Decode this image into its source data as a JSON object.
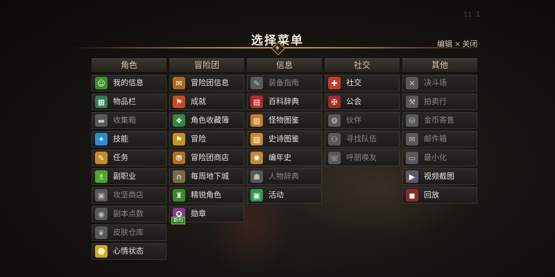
{
  "background": {
    "corner_number": "11 1"
  },
  "header": {
    "title": "选择菜单",
    "edit_label": "编辑",
    "close_x": "×",
    "close_label": "关闭"
  },
  "columns": [
    {
      "header": "角色",
      "items": [
        {
          "label": "我的信息",
          "icon": "character-icon",
          "glyph": "☺",
          "color": "#3f8d2f",
          "dim": false
        },
        {
          "label": "物品栏",
          "icon": "inventory-bag-icon",
          "glyph": "▦",
          "color": "#2f7d52",
          "dim": false
        },
        {
          "label": "收集箱",
          "icon": "collection-box-icon",
          "glyph": "▬",
          "color": "#777",
          "dim": true
        },
        {
          "label": "技能",
          "icon": "skill-star-icon",
          "glyph": "✦",
          "color": "#2a8fcf",
          "dim": false
        },
        {
          "label": "任务",
          "icon": "quest-scroll-icon",
          "glyph": "✎",
          "color": "#c98a2a",
          "dim": false
        },
        {
          "label": "副职业",
          "icon": "potion-icon",
          "glyph": "♗",
          "color": "#4fa52a",
          "dim": false
        },
        {
          "label": "攻坚商店",
          "icon": "raid-shop-icon",
          "glyph": "▣",
          "color": "#777",
          "dim": true
        },
        {
          "label": "副本点数",
          "icon": "dungeon-points-icon",
          "glyph": "◉",
          "color": "#777",
          "dim": true
        },
        {
          "label": "皮肤仓库",
          "icon": "skin-storage-icon",
          "glyph": "❦",
          "color": "#777",
          "dim": true
        },
        {
          "label": "心情状态",
          "icon": "mood-smiley-icon",
          "glyph": "☻",
          "color": "#d8a81a",
          "dim": false
        }
      ]
    },
    {
      "header": "冒险团",
      "items": [
        {
          "label": "冒险团信息",
          "icon": "guild-scroll-icon",
          "glyph": "✉",
          "color": "#b06820",
          "dim": false
        },
        {
          "label": "成就",
          "icon": "achievement-banner-icon",
          "glyph": "⚑",
          "color": "#c84a20",
          "dim": false
        },
        {
          "label": "角色收藏簿",
          "icon": "character-album-icon",
          "glyph": "❖",
          "color": "#2f8a3a",
          "dim": false
        },
        {
          "label": "冒险",
          "icon": "adventure-flag-icon",
          "glyph": "⚑",
          "color": "#c8901a",
          "dim": false
        },
        {
          "label": "冒险团商店",
          "icon": "guild-shop-icon",
          "glyph": "⛃",
          "color": "#b07020",
          "dim": false
        },
        {
          "label": "每周地下城",
          "icon": "weekly-dungeon-gate-icon",
          "glyph": "∩",
          "color": "#7a6a4a",
          "dim": false
        },
        {
          "label": "精锐角色",
          "icon": "elite-character-icon",
          "glyph": "♜",
          "color": "#3a8a2a",
          "dim": false
        },
        {
          "label": "勋章",
          "icon": "medal-icon",
          "glyph": "✪",
          "color": "#8a3a8a",
          "dim": false,
          "badge": "新的"
        }
      ]
    },
    {
      "header": "信息",
      "items": [
        {
          "label": "装备指南",
          "icon": "equipment-guide-icon",
          "glyph": "✎",
          "color": "#777",
          "dim": true
        },
        {
          "label": "百科辞典",
          "icon": "encyclopedia-book-icon",
          "glyph": "▤",
          "color": "#b82a2a",
          "dim": false
        },
        {
          "label": "怪物图鉴",
          "icon": "monster-book-icon",
          "glyph": "▥",
          "color": "#c87a2a",
          "dim": false
        },
        {
          "label": "史诗图鉴",
          "icon": "epic-book-icon",
          "glyph": "▧",
          "color": "#d08a2a",
          "dim": false
        },
        {
          "label": "编年史",
          "icon": "chronicle-gear-icon",
          "glyph": "✺",
          "color": "#c08a3a",
          "dim": false
        },
        {
          "label": "人物辞典",
          "icon": "character-dictionary-icon",
          "glyph": "☗",
          "color": "#777",
          "dim": true
        },
        {
          "label": "活动",
          "icon": "event-box-icon",
          "glyph": "▣",
          "color": "#2f9a4a",
          "dim": false
        }
      ]
    },
    {
      "header": "社交",
      "items": [
        {
          "label": "社交",
          "icon": "social-badge-icon",
          "glyph": "✚",
          "color": "#c83a2a",
          "dim": false
        },
        {
          "label": "公会",
          "icon": "guild-crest-icon",
          "glyph": "✠",
          "color": "#a82a2a",
          "dim": false
        },
        {
          "label": "伙伴",
          "icon": "partner-wings-icon",
          "glyph": "❂",
          "color": "#777",
          "dim": true
        },
        {
          "label": "寻找队伍",
          "icon": "find-party-icon",
          "glyph": "⚇",
          "color": "#777",
          "dim": true
        },
        {
          "label": "呼朋唤友",
          "icon": "call-friends-icon",
          "glyph": "☏",
          "color": "#777",
          "dim": true
        }
      ]
    },
    {
      "header": "其他",
      "items": [
        {
          "label": "决斗场",
          "icon": "duel-swords-icon",
          "glyph": "✕",
          "color": "#777",
          "dim": true
        },
        {
          "label": "拍卖行",
          "icon": "auction-hammer-icon",
          "glyph": "⚒",
          "color": "#777",
          "dim": true
        },
        {
          "label": "金币寄售",
          "icon": "gold-consign-icon",
          "glyph": "⛁",
          "color": "#777",
          "dim": true
        },
        {
          "label": "邮件箱",
          "icon": "mailbox-icon",
          "glyph": "✉",
          "color": "#777",
          "dim": true
        },
        {
          "label": "最小化",
          "icon": "minimize-window-icon",
          "glyph": "▭",
          "color": "#777",
          "dim": true
        },
        {
          "label": "视频截图",
          "icon": "video-capture-icon",
          "glyph": "▶",
          "color": "#5a5a6a",
          "dim": false
        },
        {
          "label": "回放",
          "icon": "replay-icon",
          "glyph": "◼",
          "color": "#8a2a2a",
          "dim": false
        }
      ]
    }
  ]
}
